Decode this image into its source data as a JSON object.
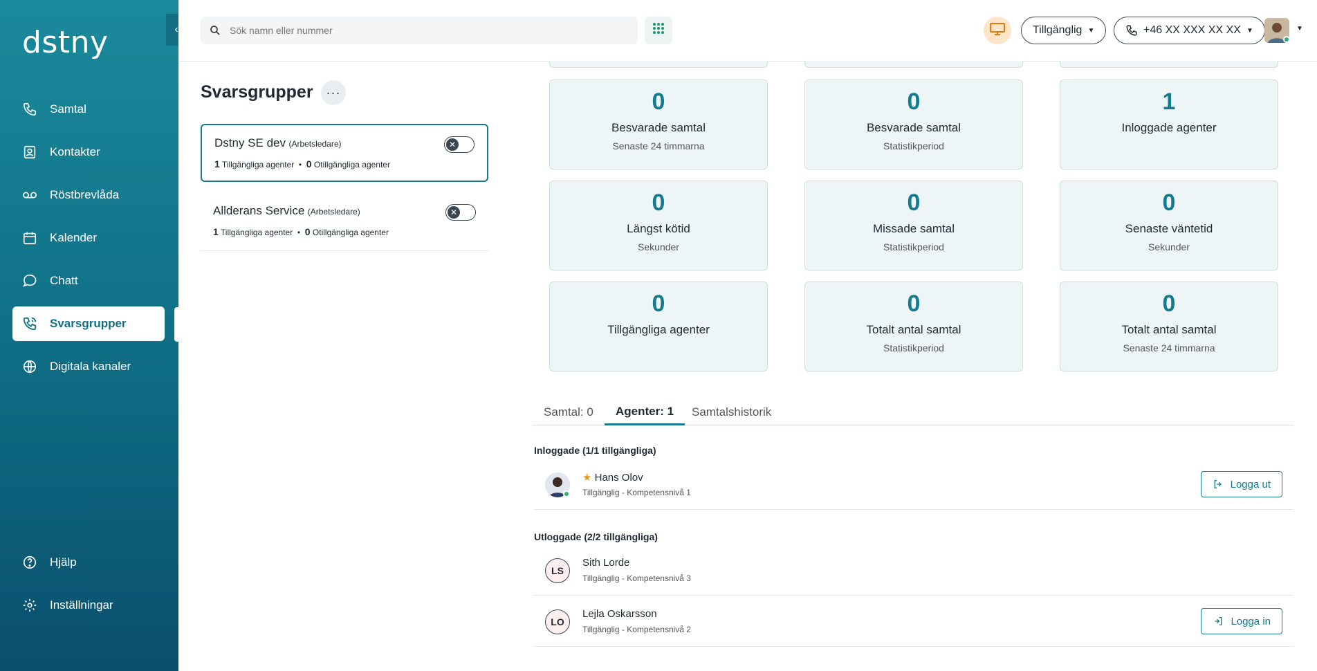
{
  "app": {
    "logo": "dstny"
  },
  "sidebar": {
    "items": [
      {
        "label": "Samtal",
        "icon": "phone-icon"
      },
      {
        "label": "Kontakter",
        "icon": "contacts-icon"
      },
      {
        "label": "Röstbrevlåda",
        "icon": "voicemail-icon"
      },
      {
        "label": "Kalender",
        "icon": "calendar-icon"
      },
      {
        "label": "Chatt",
        "icon": "chat-icon"
      },
      {
        "label": "Svarsgrupper",
        "icon": "group-phone-icon",
        "active": true
      },
      {
        "label": "Digitala kanaler",
        "icon": "globe-icon"
      }
    ],
    "bottom": [
      {
        "label": "Hjälp",
        "icon": "help-icon"
      },
      {
        "label": "Inställningar",
        "icon": "gear-icon"
      }
    ]
  },
  "topbar": {
    "search_placeholder": "Sök namn eller nummer",
    "status": "Tillgänglig",
    "phone": "+46 XX XXX XX XX"
  },
  "groups": {
    "title": "Svarsgrupper",
    "more": "···",
    "list": [
      {
        "name": "Dstny SE dev",
        "role": "(Arbetsledare)",
        "available": "1",
        "available_label": "Tillgängliga agenter",
        "unavailable": "0",
        "unavailable_label": "Otillgängliga agenter"
      },
      {
        "name": "Allderans Service",
        "role": "(Arbetsledare)",
        "available": "1",
        "available_label": "Tillgängliga agenter",
        "unavailable": "0",
        "unavailable_label": "Otillgängliga agenter"
      }
    ]
  },
  "stats": [
    {
      "value": "0",
      "label": "Besvarade samtal",
      "sub": "Senaste 24 timmarna"
    },
    {
      "value": "0",
      "label": "Besvarade samtal",
      "sub": "Statistikperiod"
    },
    {
      "value": "1",
      "label": "Inloggade agenter",
      "sub": ""
    },
    {
      "value": "0",
      "label": "Längst kötid",
      "sub": "Sekunder"
    },
    {
      "value": "0",
      "label": "Missade samtal",
      "sub": "Statistikperiod"
    },
    {
      "value": "0",
      "label": "Senaste väntetid",
      "sub": "Sekunder"
    },
    {
      "value": "0",
      "label": "Tillgängliga agenter",
      "sub": ""
    },
    {
      "value": "0",
      "label": "Totalt antal samtal",
      "sub": "Statistikperiod"
    },
    {
      "value": "0",
      "label": "Totalt antal samtal",
      "sub": "Senaste 24 timmarna"
    }
  ],
  "tabs": [
    {
      "label": "Samtal: 0"
    },
    {
      "label": "Agenter: 1",
      "active": true
    },
    {
      "label": "Samtalshistorik"
    }
  ],
  "agents": {
    "logged_in_heading": "Inloggade (1/1 tillgängliga)",
    "logged_out_heading": "Utloggade (2/2 tillgängliga)",
    "logged_in": [
      {
        "name": "Hans Olov",
        "meta": "Tillgänglig - Kompetensnivå 1",
        "action": "Logga ut"
      }
    ],
    "logged_out": [
      {
        "initials": "LS",
        "name": "Sith Lorde",
        "meta": "Tillgänglig - Kompetensnivå 3"
      },
      {
        "initials": "LO",
        "name": "Lejla Oskarsson",
        "meta": "Tillgänglig - Kompetensnivå 2",
        "action": "Logga in"
      }
    ]
  }
}
